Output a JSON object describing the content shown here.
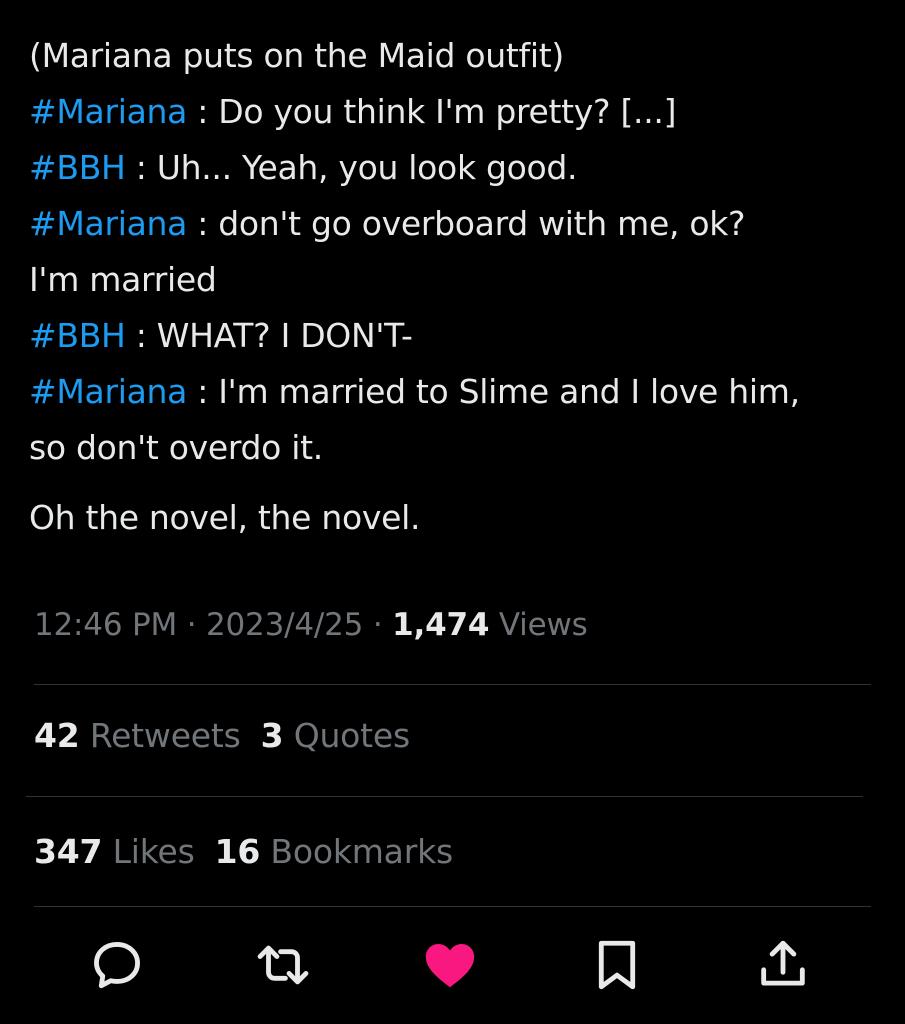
{
  "tweet": {
    "lines": [
      {
        "text": "(Mariana puts on the Maid outfit)"
      },
      {
        "tag": "#Mariana",
        "sep": " : ",
        "text": "Do you think I'm pretty? [...]"
      },
      {
        "tag": "#BBH",
        "sep": " : ",
        "text": "Uh... Yeah, you look good."
      },
      {
        "tag": "#Mariana",
        "sep": " : ",
        "text": "don't go overboard with me, ok?"
      },
      {
        "text": "I'm married"
      },
      {
        "tag": "#BBH",
        "sep": " : ",
        "text": "WHAT? I DON'T-"
      },
      {
        "tag": "#Mariana",
        "sep": " : ",
        "text": "I'm married to Slime and I love him,"
      },
      {
        "text": "so don't overdo it."
      }
    ],
    "tail": "Oh the novel, the novel."
  },
  "meta": {
    "time": "12:46 PM",
    "dot1": " · ",
    "date": "2023/4/25",
    "dot2": " · ",
    "views_count": "1,474",
    "views_label": " Views"
  },
  "stats1": {
    "retweets_count": "42",
    "retweets_label": " Retweets",
    "quotes_count": "3",
    "quotes_label": " Quotes"
  },
  "stats2": {
    "likes_count": "347",
    "likes_label": " Likes",
    "bookmarks_count": "16",
    "bookmarks_label": " Bookmarks"
  },
  "actions": {
    "reply_icon": "reply-icon",
    "retweet_icon": "retweet-icon",
    "like_icon": "heart-icon",
    "bookmark_icon": "bookmark-icon",
    "share_icon": "share-icon"
  },
  "colors": {
    "background": "#000000",
    "text": "#e7e9ea",
    "muted": "#71767b",
    "link": "#1d9bf0",
    "like": "#f91880",
    "divider": "#2f3336"
  }
}
